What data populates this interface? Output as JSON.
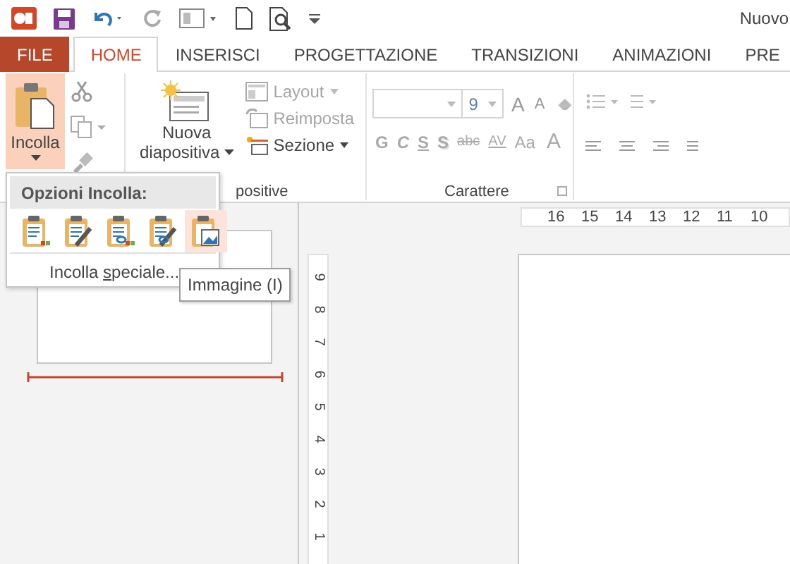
{
  "window": {
    "title": "Nuovo"
  },
  "tabs": [
    {
      "label": "FILE",
      "kind": "file",
      "selected": false
    },
    {
      "label": "HOME",
      "kind": "tab",
      "selected": true
    },
    {
      "label": "INSERISCI",
      "kind": "tab",
      "selected": false
    },
    {
      "label": "PROGETTAZIONE",
      "kind": "tab",
      "selected": false
    },
    {
      "label": "TRANSIZIONI",
      "kind": "tab",
      "selected": false
    },
    {
      "label": "ANIMAZIONI",
      "kind": "tab",
      "selected": false
    },
    {
      "label": "PRE",
      "kind": "tab",
      "selected": false
    }
  ],
  "clipboard": {
    "paste_label": "Incolla",
    "paste_pressed": true
  },
  "slides": {
    "new_slide_lines": [
      "Nuova",
      "diapositiva"
    ],
    "group_label": "positive",
    "commands": [
      {
        "label": "Layout",
        "kind": "layout",
        "disabled": true
      },
      {
        "label": "Reimposta",
        "kind": "reset",
        "disabled": true
      },
      {
        "label": "Sezione",
        "kind": "section",
        "disabled": false
      }
    ]
  },
  "font": {
    "size": "9",
    "group_label": "Carattere",
    "grow_label": "A",
    "shrink_label": "A",
    "color_label": "A",
    "format_buttons": [
      {
        "label": "G",
        "kind": "bold"
      },
      {
        "label": "C",
        "kind": "italic"
      },
      {
        "label": "S",
        "kind": "underline"
      },
      {
        "label": "S",
        "kind": "shadow"
      },
      {
        "label": "abc",
        "kind": "strike"
      },
      {
        "label": "AV",
        "kind": "spacing"
      },
      {
        "label": "Aa",
        "kind": "case"
      }
    ]
  },
  "paste_menu": {
    "header": "Opzioni Incolla:",
    "options": [
      {
        "selected": false
      },
      {
        "selected": false
      },
      {
        "selected": false
      },
      {
        "selected": false
      },
      {
        "selected": true
      }
    ],
    "special_parts": [
      "Incolla ",
      "s",
      "peciale..."
    ]
  },
  "tooltip": "Immagine (I)",
  "horizontal_ruler": [
    "16",
    "15",
    "14",
    "13",
    "12",
    "11",
    "10"
  ],
  "vertical_ruler": [
    "9",
    "8",
    "7",
    "6",
    "5",
    "4",
    "3",
    "2",
    "1"
  ]
}
